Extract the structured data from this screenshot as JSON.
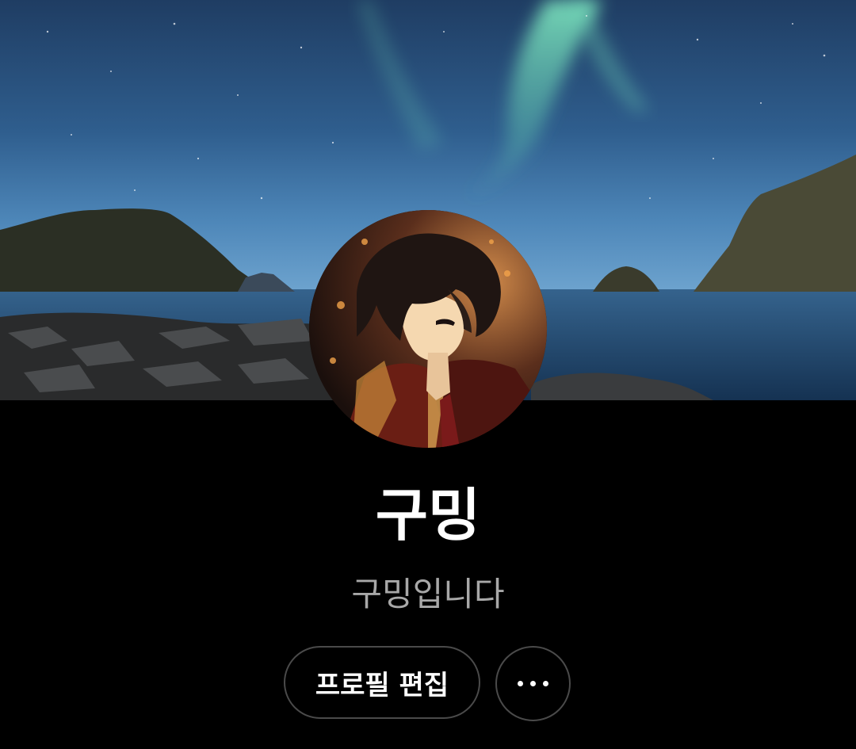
{
  "profile": {
    "name": "구밍",
    "bio": "구밍입니다"
  },
  "actions": {
    "edit_label": "프로필 편집",
    "more_icon": "ellipsis-icon"
  },
  "images": {
    "cover": "aurora-night-sky-sea-cover",
    "avatar": "anime-character-avatar"
  },
  "colors": {
    "background": "#000000",
    "name_text": "#ffffff",
    "bio_text": "#a8a8a8",
    "button_border": "#4a4a4a"
  }
}
